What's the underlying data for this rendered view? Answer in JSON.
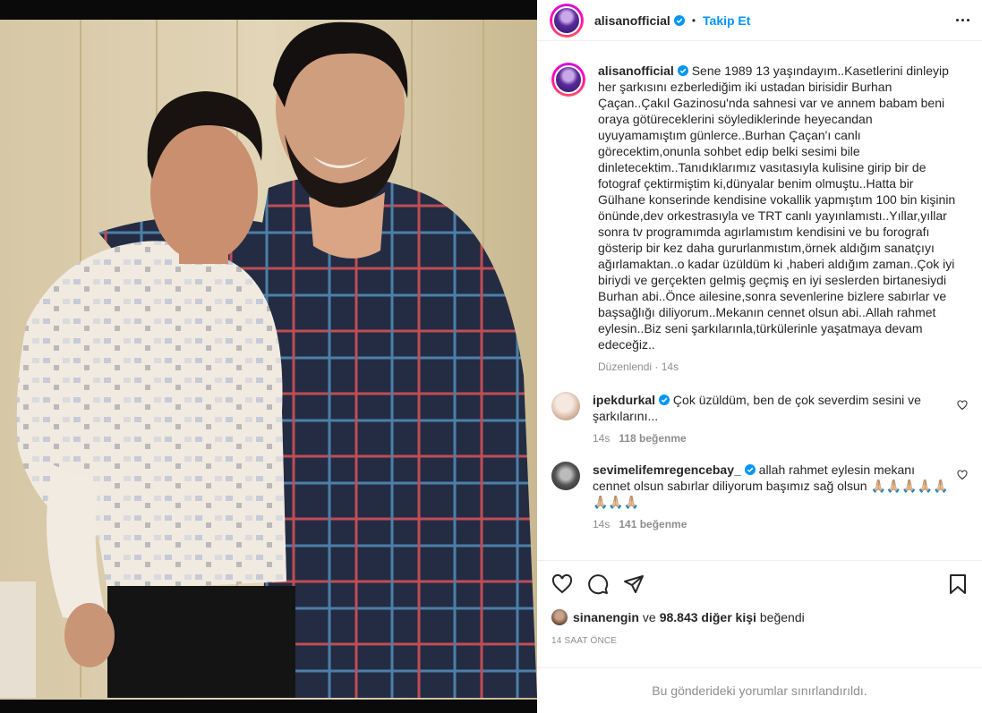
{
  "post": {
    "username": "alisanofficial",
    "follow_label": "Takip Et",
    "separator": "•",
    "caption": "Sene 1989 13 yaşındayım..Kasetlerini dinleyip her şarkısını ezberlediğim iki ustadan birisidir Burhan Çaçan..Çakıl Gazinosu'nda sahnesi var ve annem babam beni oraya götüreceklerini söylediklerinde heyecandan uyuyamamıştım günlerce..Burhan Çaçan'ı canlı görecektim,onunla sohbet edip belki sesimi bile dinletecektim..Tanıdıklarımız vasıtasıyla kulisine girip bir de fotograf çektirmiştim ki,dünyalar benim olmuştu..Hatta bir Gülhane konserinde kendisine vokallik yapmıştım 100 bin kişinin önünde,dev orkestrasıyla ve TRT canlı yayınlamıstı..Yıllar,yıllar sonra tv programımda agırlamıstım kendisini ve bu forografı gösterip bir kez daha gururlanmıstım,örnek aldığım sanatçıyı ağırlamaktan..o kadar üzüldüm ki ,haberi aldığım zaman..Çok iyi biriydi ve gerçekten gelmiş geçmiş en iyi seslerden birtanesiydi Burhan abi..Önce ailesine,sonra sevenlerine bizlere sabırlar ve başsağlığı diliyorum..Mekanın cennet olsun abi..Allah rahmet eylesin..Biz seni şarkılarınla,türkülerinle yaşatmaya devam edeceğiz..",
    "edited_label": "Düzenlendi",
    "edited_time": "14s",
    "liked_by_user": "sinanengin",
    "liked_and": "ve",
    "liked_others": "98.843 diğer kişi",
    "liked_suffix": "beğendi",
    "time_ago": "14 SAAT ÖNCE",
    "restricted_notice": "Bu gönderideki yorumlar sınırlandırıldı."
  },
  "comments": [
    {
      "username": "ipekdurkal",
      "text": "Çok üzüldüm, ben de çok severdim sesini ve şarkılarını...",
      "time": "14s",
      "likes": "118 beğenme"
    },
    {
      "username": "sevimelifemregencebay_",
      "text": "allah rahmet eylesin mekanı cennet olsun sabırlar diliyorum başımız sağ olsun 🙏🏼🙏🏼🙏🏼🙏🏼🙏🏼🙏🏼🙏🏼🙏🏼",
      "time": "14s",
      "likes": "141 beğenme"
    }
  ],
  "colors": {
    "accent": "#0095f6",
    "muted": "#8e8e8e",
    "text": "#262626",
    "border": "#efefef"
  },
  "icons": {
    "verified": "verified-badge-icon",
    "more": "more-options-icon",
    "like": "heart-icon",
    "comment": "comment-icon",
    "share": "paper-plane-icon",
    "save": "bookmark-icon"
  }
}
